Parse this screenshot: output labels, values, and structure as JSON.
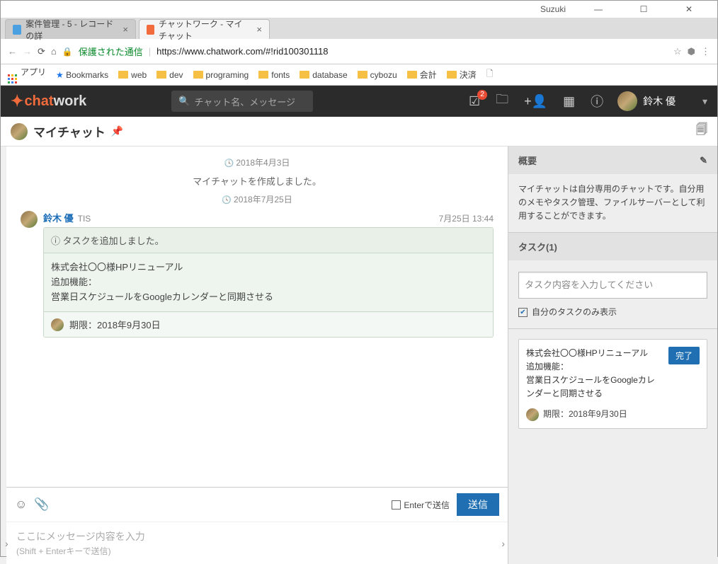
{
  "window": {
    "user": "Suzuki"
  },
  "tabs": [
    {
      "title": "案件管理 - 5 - レコードの詳",
      "favcolor": "#4aa0e0"
    },
    {
      "title": "チャットワーク - マイチャット",
      "favcolor": "#f26b3c"
    }
  ],
  "url": {
    "secure": "保護された通信",
    "full": "https://www.chatwork.com/#!rid100301118"
  },
  "bookmarks": {
    "apps": "アプリ",
    "star": "Bookmarks",
    "items": [
      "web",
      "dev",
      "programing",
      "fonts",
      "database",
      "cybozu",
      "会計",
      "決済"
    ]
  },
  "header": {
    "search_ph": "チャット名、メッセージ",
    "username": "鈴木 優",
    "badge": "2"
  },
  "room": {
    "title": "マイチャット"
  },
  "chat": {
    "date1": "2018年4月3日",
    "sys": "マイチャットを作成しました。",
    "date2": "2018年7月25日",
    "msg": {
      "name": "鈴木 優",
      "org": "TIS",
      "time": "7月25日 13:44",
      "task_h": "タスクを追加しました。",
      "task_c": "株式会社〇〇様HPリニューアル\n追加機能：\n営業日スケジュールをGoogleカレンダーと同期させる",
      "task_due": "期限：2018年9月30日"
    }
  },
  "input": {
    "enter": "Enterで送信",
    "send": "送信",
    "ph1": "ここにメッセージ内容を入力",
    "ph2": "(Shift + Enterキーで送信)"
  },
  "side": {
    "overview_h": "概要",
    "overview_c": "マイチャットは自分専用のチャットです。自分用のメモやタスク管理、ファイルサーバーとして利用することができます。",
    "task_h": "タスク(1)",
    "task_ph": "タスク内容を入力してください",
    "ownonly": "自分のタスクのみ表示",
    "card": {
      "t": "株式会社〇〇様HPリニューアル\n追加機能：\n営業日スケジュールをGoogleカレンダーと同期させる",
      "done": "完了",
      "due": "期限：2018年9月30日"
    }
  }
}
